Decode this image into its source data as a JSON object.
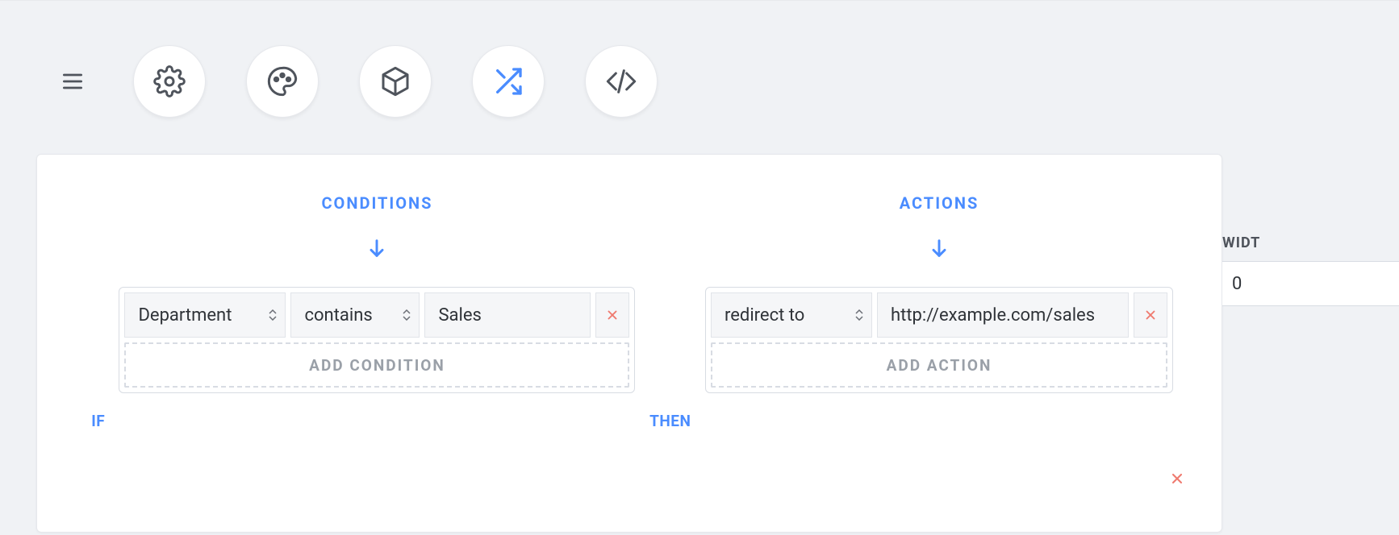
{
  "toolbar": {
    "icons": [
      "menu-icon",
      "gear-icon",
      "palette-icon",
      "cube-icon",
      "shuffle-icon",
      "code-icon"
    ]
  },
  "rule": {
    "conditions_header": "CONDITIONS",
    "actions_header": "ACTIONS",
    "if_label": "IF",
    "then_label": "THEN",
    "add_condition_label": "ADD CONDITION",
    "add_action_label": "ADD ACTION",
    "conditions": [
      {
        "field": "Department",
        "operator": "contains",
        "value": "Sales"
      }
    ],
    "actions": [
      {
        "type": "redirect to",
        "value": "http://example.com/sales"
      }
    ]
  },
  "side": {
    "label_fragment": "WIDT",
    "value_fragment": "0"
  }
}
